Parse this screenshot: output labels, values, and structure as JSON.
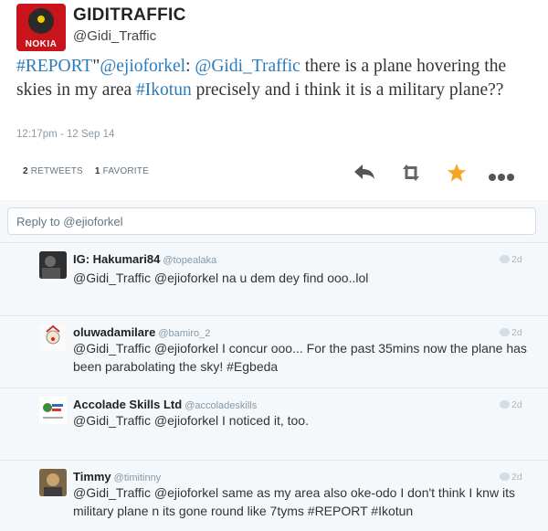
{
  "tweet": {
    "display_name": "GIDITRAFFIC",
    "screen_name": "@Gidi_Traffic",
    "avatar_brand": "NOKIA",
    "text_parts": [
      "#REPORT",
      "\"",
      "@ejioforkel",
      ": ",
      "@Gidi_Traffic",
      " there is a plane hovering the skies in my area ",
      "#Ikotun",
      " precisely and i think it is a military plane??"
    ],
    "timestamp": "12:17pm - 12 Sep 14",
    "retweets_count": "2",
    "retweets_label": "RETWEETS",
    "favorites_count": "1",
    "favorites_label": "FAVORITE",
    "icons": {
      "reply": "reply-icon",
      "retweet": "retweet-icon",
      "favorite": "star-icon",
      "more": "more-dots-icon"
    },
    "colors": {
      "link": "#2b7bb9",
      "favorite": "#f5a623",
      "avatar_bg": "#c9141b"
    }
  },
  "reply_box": {
    "placeholder": "Reply to @ejioforkel"
  },
  "replies": [
    {
      "name": "IG: Hakumari84",
      "handle": "@topealaka",
      "time": "2d",
      "text": "@Gidi_Traffic @ejioforkel na u dem dey find ooo..lol"
    },
    {
      "name": "oluwadamilare",
      "handle": "@bamiro_2",
      "time": "2d",
      "text": "@Gidi_Traffic @ejioforkel I concur ooo... For the past 35mins now the plane has been parabolating the sky! #Egbeda"
    },
    {
      "name": "Accolade Skills Ltd",
      "handle": "@accoladeskills",
      "time": "2d",
      "text": "@Gidi_Traffic @ejioforkel I noticed it, too."
    },
    {
      "name": "Timmy",
      "handle": "@timitinny",
      "time": "2d",
      "text": "@Gidi_Traffic @ejioforkel same as my area also oke-odo I don't think I knw its military plane n its gone round like 7tyms #REPORT #Ikotun"
    }
  ]
}
